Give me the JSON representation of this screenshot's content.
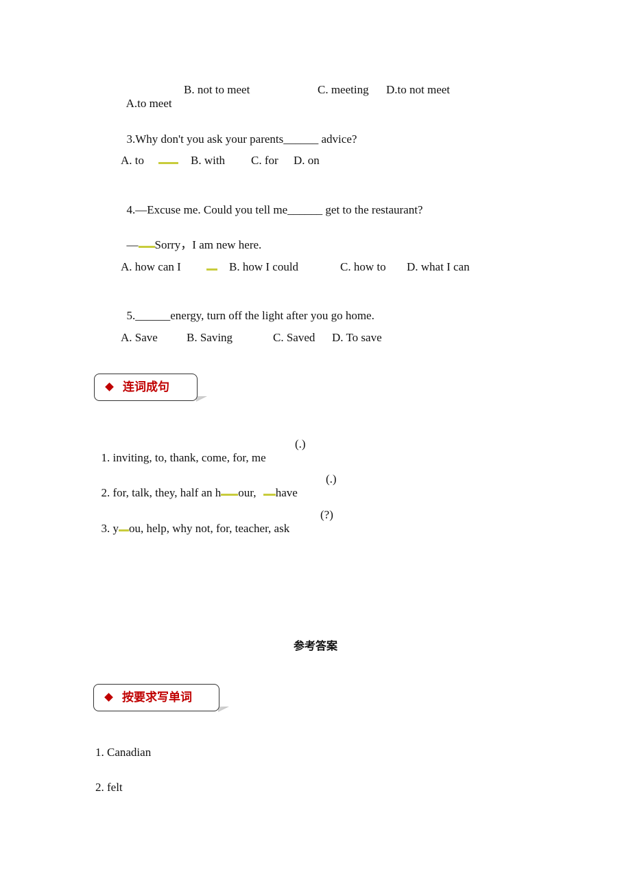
{
  "mc_questions": {
    "q2_options": {
      "a": "A.to meet",
      "b": "B. not to meet",
      "c": "C. meeting",
      "d": "D.to not meet"
    },
    "q3": {
      "prefix": "3.Why don't you ask your parents",
      "blank": "______",
      "suffix": " advice?"
    },
    "q3_options": {
      "a": "A. to",
      "b": "B. with",
      "c": "C. for",
      "d": "D. on"
    },
    "q4": {
      "prefix": "4.—Excuse me. Could you tell me",
      "blank": "______",
      "suffix": " get to the restaurant?"
    },
    "q4_reply": {
      "dash": "—",
      "text": "Sorry，I am new here."
    },
    "q4_options": {
      "a": "A. how can I",
      "b": "B. how I could",
      "c": "C. how to",
      "d": "D. what I can"
    },
    "q5": {
      "prefix": "5.",
      "blank": "______",
      "suffix": "energy, turn off the light after you go home."
    },
    "q5_options": {
      "a": "A. Save",
      "b": "B. Saving",
      "c": "C. Saved",
      "d": "D. To save"
    }
  },
  "section_sentence": {
    "title": "连词成句",
    "items": [
      {
        "text": "1. inviting, to, thank, come, for, me",
        "punct": "(.)"
      },
      {
        "text_a": "2. for, talk, they, half an h",
        "text_b": "our, ",
        "text_c": "have",
        "punct": "(.)"
      },
      {
        "text_a": "3. y",
        "text_b": "ou, help, why not, for, teacher, ask",
        "punct": "(?)"
      }
    ]
  },
  "answers": {
    "heading": "参考答案",
    "section_title": "按要求写单词",
    "items": [
      "1. Canadian",
      "2. felt"
    ]
  },
  "colors": {
    "accent_red": "#c00000",
    "highlight": "#c8cc3c"
  }
}
